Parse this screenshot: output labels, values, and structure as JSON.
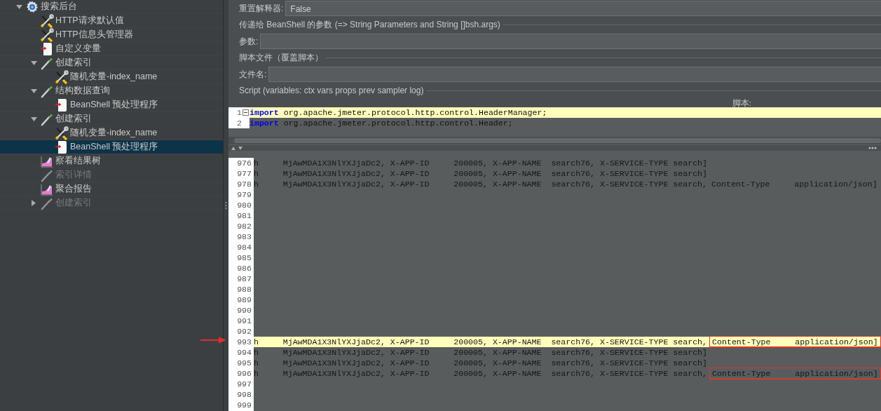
{
  "tree": {
    "label": "搜索后台",
    "kind": "plan",
    "expanded": true,
    "selected": false,
    "disabled": false,
    "children": [
      {
        "label": "HTTP请求默认值",
        "kind": "config",
        "selected": false,
        "disabled": false
      },
      {
        "label": "HTTP信息头管理器",
        "kind": "config",
        "selected": false,
        "disabled": false
      },
      {
        "label": "自定义变量",
        "kind": "preprocessor",
        "selected": false,
        "disabled": false
      },
      {
        "label": "创建索引",
        "kind": "sampler",
        "expanded": true,
        "selected": false,
        "disabled": false,
        "children": [
          {
            "label": "随机变量-index_name",
            "kind": "config",
            "selected": false,
            "disabled": false
          }
        ]
      },
      {
        "label": "结构数据查询",
        "kind": "sampler",
        "expanded": true,
        "selected": false,
        "disabled": false,
        "children": [
          {
            "label": "BeanShell 预处理程序",
            "kind": "preprocessor",
            "selected": false,
            "disabled": false
          }
        ]
      },
      {
        "label": "创建索引",
        "kind": "sampler",
        "expanded": true,
        "selected": false,
        "disabled": false,
        "children": [
          {
            "label": "随机变量-index_name",
            "kind": "config",
            "selected": false,
            "disabled": false
          },
          {
            "label": "BeanShell 预处理程序",
            "kind": "preprocessor",
            "selected": true,
            "disabled": false
          }
        ]
      },
      {
        "label": "察看结果树",
        "kind": "listener",
        "selected": false,
        "disabled": false
      },
      {
        "label": "索引详情",
        "kind": "sampler",
        "selected": false,
        "disabled": true
      },
      {
        "label": "聚合报告",
        "kind": "listener",
        "selected": false,
        "disabled": false
      },
      {
        "label": "创建索引",
        "kind": "sampler",
        "expanded": false,
        "selected": false,
        "disabled": true
      }
    ]
  },
  "form": {
    "reset_interpreter": {
      "label": "重置解释器:",
      "value": "False"
    },
    "parameters_legend": "传递给 BeanShell 的参数 (=> String Parameters and String []bsh.args)",
    "parameters": {
      "label": "参数:"
    },
    "file_legend": "脚本文件（覆盖脚本）",
    "file_name": {
      "label": "文件名:"
    },
    "script_legend": "Script (variables: ctx vars props prev sampler log)",
    "script_label": "脚本:"
  },
  "script_editor": {
    "lines": [
      {
        "number": "1",
        "current": true,
        "foldable": true,
        "segments": [
          {
            "kind": "keyword",
            "text": "import"
          },
          {
            "kind": "plain",
            "text": " org.apache.jmeter.protocol.http.control.HeaderManager;"
          }
        ]
      },
      {
        "number": "2",
        "current": false,
        "foldable": false,
        "segments": [
          {
            "kind": "keyword",
            "text": "import"
          },
          {
            "kind": "plain",
            "text": " org.apache.jmeter.protocol.http.control.Header;"
          }
        ]
      }
    ]
  },
  "output_editor": {
    "lines": [
      {
        "number": "976",
        "current": false,
        "text": "h     MjAwMDA1X3NlYXJjaDc2, X-APP-ID     200005, X-APP-NAME  search76, X-SERVICE-TYPE search]"
      },
      {
        "number": "977",
        "current": false,
        "text": "h     MjAwMDA1X3NlYXJjaDc2, X-APP-ID     200005, X-APP-NAME  search76, X-SERVICE-TYPE search]"
      },
      {
        "number": "978",
        "current": false,
        "text": "h     MjAwMDA1X3NlYXJjaDc2, X-APP-ID     200005, X-APP-NAME  search76, X-SERVICE-TYPE search,",
        "tail": "Content-Type     application/json]",
        "boxed": false
      },
      {
        "number": "979",
        "current": false
      },
      {
        "number": "980",
        "current": false
      },
      {
        "number": "981",
        "current": false
      },
      {
        "number": "982",
        "current": false
      },
      {
        "number": "983",
        "current": false
      },
      {
        "number": "984",
        "current": false
      },
      {
        "number": "985",
        "current": false
      },
      {
        "number": "986",
        "current": false
      },
      {
        "number": "987",
        "current": false
      },
      {
        "number": "988",
        "current": false
      },
      {
        "number": "989",
        "current": false
      },
      {
        "number": "990",
        "current": false
      },
      {
        "number": "991",
        "current": false
      },
      {
        "number": "992",
        "current": false
      },
      {
        "number": "993",
        "current": true,
        "text": "h     MjAwMDA1X3NlYXJjaDc2, X-APP-ID     200005, X-APP-NAME  search76, X-SERVICE-TYPE search,",
        "tail": "Content-Type     application/json]",
        "boxed": true
      },
      {
        "number": "994",
        "current": false,
        "text": "h     MjAwMDA1X3NlYXJjaDc2, X-APP-ID     200005, X-APP-NAME  search76, X-SERVICE-TYPE search]"
      },
      {
        "number": "995",
        "current": false,
        "text": "h     MjAwMDA1X3NlYXJjaDc2, X-APP-ID     200005, X-APP-NAME  search76, X-SERVICE-TYPE search]"
      },
      {
        "number": "996",
        "current": false,
        "text": "h     MjAwMDA1X3NlYXJjaDc2, X-APP-ID     200005, X-APP-NAME  search76, X-SERVICE-TYPE search,",
        "tail": "Content-Type     application/json]",
        "boxed": true
      },
      {
        "number": "997",
        "current": false
      },
      {
        "number": "998",
        "current": false
      },
      {
        "number": "999",
        "current": false
      }
    ]
  }
}
